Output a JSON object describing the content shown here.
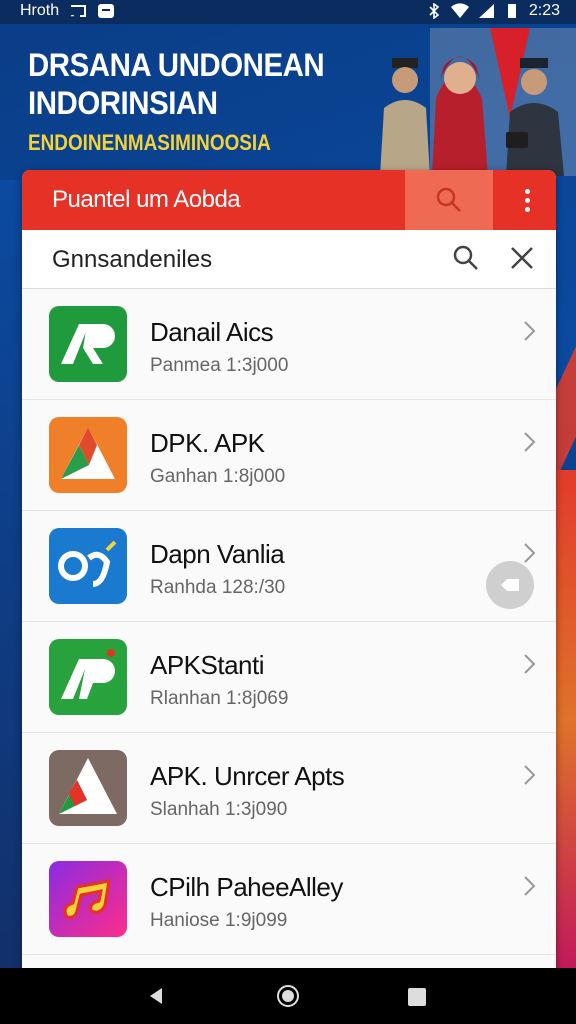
{
  "status_bar": {
    "left_text": "Hroth",
    "time": "2:23"
  },
  "banner": {
    "line1": "DRSANA UNDONEAN",
    "line2": "INDORINSIAN",
    "line3": "ENDOINENMASIMINOOSIA"
  },
  "app_bar": {
    "title": "Puantel um Aobda"
  },
  "search": {
    "value": "Gnnsandeniles"
  },
  "apps": [
    {
      "name": "Danail Aics",
      "sub": "Panmea 1:3j000",
      "icon": "ap-green-icon",
      "color": "#1f9a3d"
    },
    {
      "name": "DPK. APK",
      "sub": "Ganhan 1:8j000",
      "icon": "a-orange-icon",
      "color": "#f07f2a"
    },
    {
      "name": "Dapn Vanlia",
      "sub": "Ranhda 128:/30",
      "icon": "og-blue-icon",
      "color": "#1a7ad0"
    },
    {
      "name": "APKStanti",
      "sub": "Rlanhan 1:8j069",
      "icon": "ap-green-icon",
      "color": "#28a23c"
    },
    {
      "name": "APK. Unrcer Apts",
      "sub": "Slanhah 1:3j090",
      "icon": "a-brown-icon",
      "color": "#7d6a63"
    },
    {
      "name": "CPilh PaheeAlley",
      "sub": "Haniose 1:9j099",
      "icon": "music-pink-icon",
      "color": "#d42a9c"
    }
  ]
}
